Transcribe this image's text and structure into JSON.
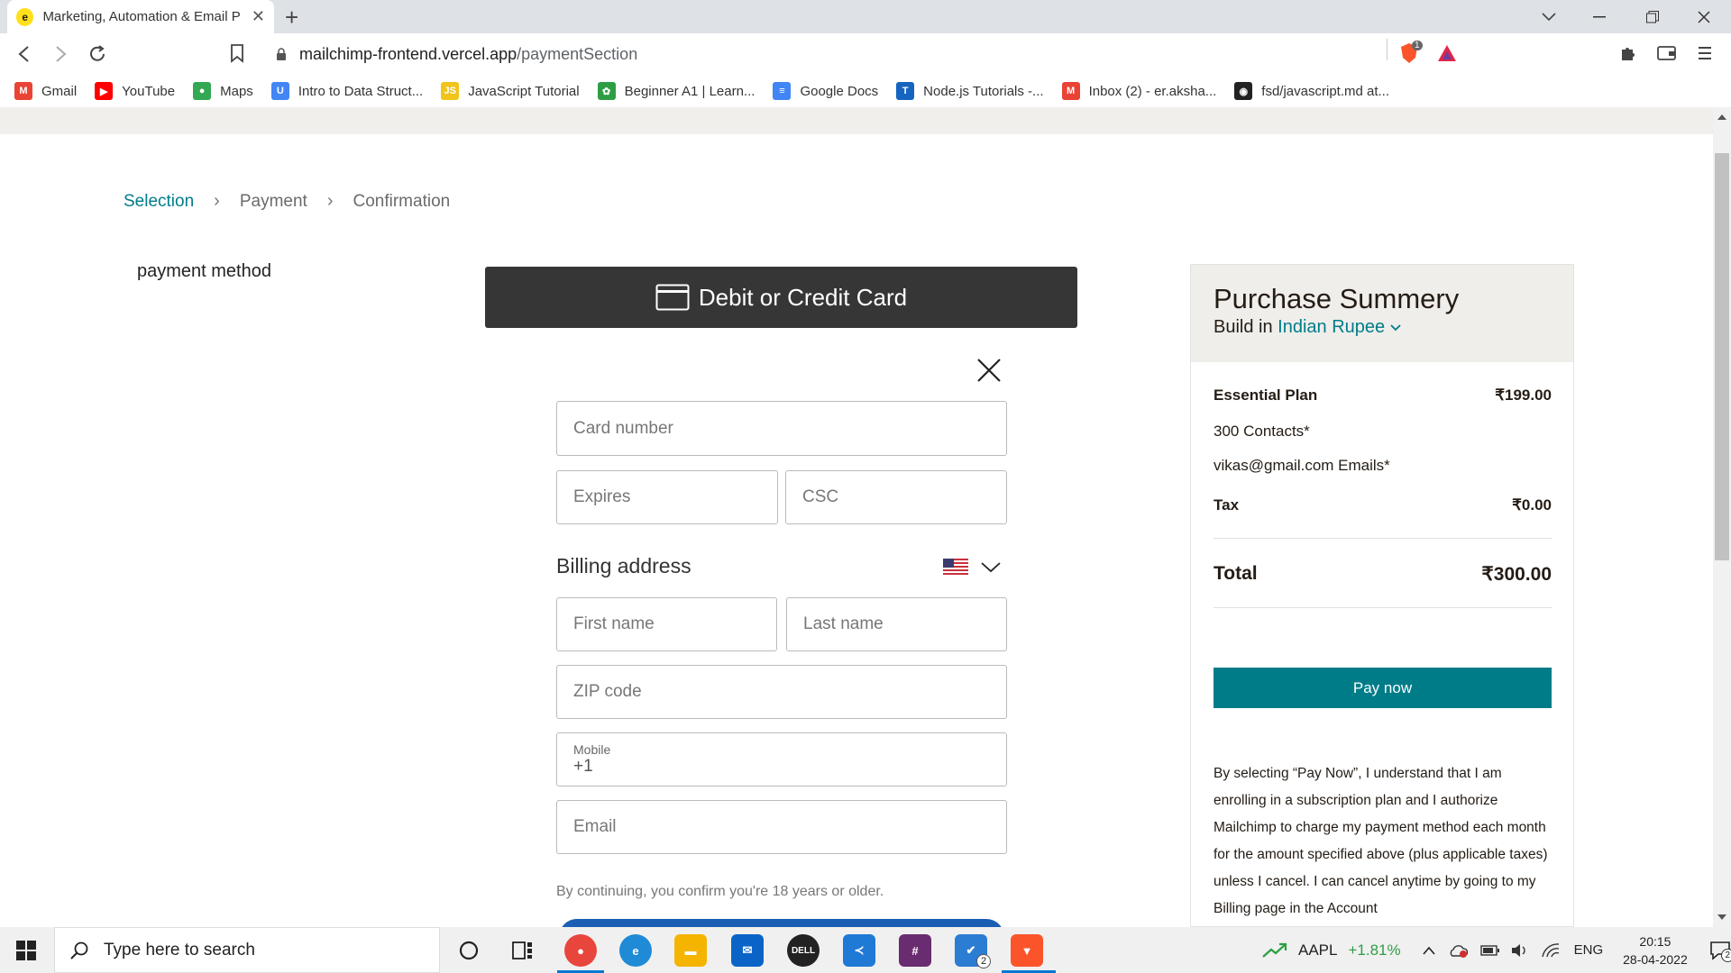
{
  "browser": {
    "tab_title": "Marketing, Automation & Email P",
    "url_host": "mailchimp-frontend.vercel.app",
    "url_path": "/paymentSection",
    "brave_badge": "1",
    "bookmarks": [
      {
        "label": "Gmail",
        "icon": "gmail-icon",
        "color": "#ea4335",
        "glyph": "M"
      },
      {
        "label": "YouTube",
        "icon": "youtube-icon",
        "color": "#ff0000",
        "glyph": "▶"
      },
      {
        "label": "Maps",
        "icon": "maps-icon",
        "color": "#34a853",
        "glyph": "●"
      },
      {
        "label": "Intro to Data Struct...",
        "icon": "udemy-icon",
        "color": "#4285f4",
        "glyph": "U"
      },
      {
        "label": "JavaScript Tutorial",
        "icon": "js-icon",
        "color": "#f0c419",
        "glyph": "JS"
      },
      {
        "label": "Beginner A1 | Learn...",
        "icon": "duolingo-icon",
        "color": "#2e9e44",
        "glyph": "✿"
      },
      {
        "label": "Google Docs",
        "icon": "docs-icon",
        "color": "#4285f4",
        "glyph": "≡"
      },
      {
        "label": "Node.js Tutorials -...",
        "icon": "tutorials-icon",
        "color": "#1565c0",
        "glyph": "T"
      },
      {
        "label": "Inbox (2) - er.aksha...",
        "icon": "gmail-inbox-icon",
        "color": "#ea4335",
        "glyph": "M"
      },
      {
        "label": "fsd/javascript.md at...",
        "icon": "github-icon",
        "color": "#222222",
        "glyph": "◉"
      }
    ]
  },
  "steps": [
    "Selection",
    "Payment",
    "Confirmation"
  ],
  "payment_method_label": "payment method",
  "card_tab_label": "Debit or Credit Card",
  "form": {
    "card_number": "Card number",
    "expires": "Expires",
    "csc": "CSC",
    "billing_title": "Billing address",
    "first_name": "First name",
    "last_name": "Last name",
    "zip": "ZIP code",
    "mobile_label": "Mobile",
    "mobile_value": "+1",
    "email": "Email",
    "age_note": "By continuing, you confirm you're 18 years or older."
  },
  "summary": {
    "title": "Purchase Summery",
    "build_in": "Build in",
    "currency": "Indian Rupee",
    "plan_name": "Essential Plan",
    "plan_price": "₹199.00",
    "contacts": "300 Contacts*",
    "emails": "vikas@gmail.com Emails*",
    "tax_label": "Tax",
    "tax_value": "₹0.00",
    "total_label": "Total",
    "total_value": "₹300.00",
    "pay_button": "Pay now",
    "legal": "By selecting “Pay Now”, I understand that I am enrolling in a subscription plan and I authorize Mailchimp to charge my payment method each month for the amount specified above (plus applicable taxes) unless I cancel. I can cancel anytime by going to my Billing page in the Account"
  },
  "taskbar": {
    "search_placeholder": "Type here to search",
    "stock_symbol": "AAPL",
    "stock_change": "+1.81%",
    "language": "ENG",
    "time": "20:15",
    "date": "28-04-2022",
    "notification_count": "2"
  },
  "colors": {
    "accent": "#007c89",
    "dark_tab": "#363636",
    "summary_head": "#efeeea"
  }
}
